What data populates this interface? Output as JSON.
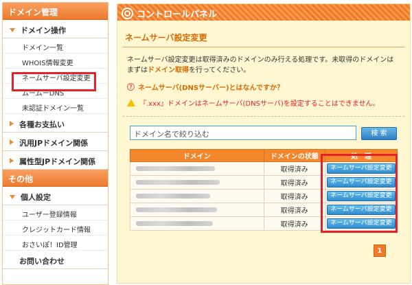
{
  "sidebar": {
    "header": "ドメイン管理",
    "sections": [
      {
        "label": "ドメイン操作",
        "open": true
      },
      {
        "label": "各種お支払い",
        "open": false
      },
      {
        "label": "汎用JPドメイン関係",
        "open": false
      },
      {
        "label": "属性型JPドメイン関係",
        "open": false
      }
    ],
    "domain_ops": [
      "ドメイン一覧",
      "WHOIS情報変更",
      "ネームサーバ設定変更",
      "ムームーDNS",
      "未認証ドメイン一覧"
    ],
    "other_header": "その他",
    "personal": "個人設定",
    "personal_items": [
      "ユーザー登録情報",
      "クレジットカード情報",
      "おさいぽ！ID管理"
    ],
    "contact": "お問い合わせ"
  },
  "panel": {
    "title": "コントロールパネル",
    "section_title": "ネームサーバ設定変更",
    "desc_line1": "ネームサーバ設定変更は取得済みのドメインのみ行える処理です。未取得のドメインは",
    "desc_line2a": "まずは",
    "desc_line2b": "ドメイン取得",
    "desc_line2c": "を行ってください。",
    "faq": "ネームサーバ(DNSサーバー)とはなんですか？",
    "warning": "『.xxx』ドメインはネームサーバ(DNSサーバ)を設定することはできません。",
    "search_placeholder": "ドメイン名で絞り込む",
    "search_button": "検 索"
  },
  "table": {
    "headers": [
      "ドメイン",
      "ドメインの状態",
      "処　理"
    ],
    "rows": [
      {
        "status": "取得済み",
        "action": "ネームサーバ設定変更"
      },
      {
        "status": "取得済み",
        "action": "ネームサーバ設定変更"
      },
      {
        "status": "取得済み",
        "action": "ネームサーバ設定変更"
      },
      {
        "status": "取得済み",
        "action": "ネームサーバ設定変更"
      },
      {
        "status": "取得済み",
        "action": "ネームサーバ設定変更"
      }
    ]
  },
  "pagination": {
    "current": "1"
  },
  "colors": {
    "accent": "#f07a28",
    "highlight": "#e8202a",
    "button_blue": "#2d8ccf"
  }
}
